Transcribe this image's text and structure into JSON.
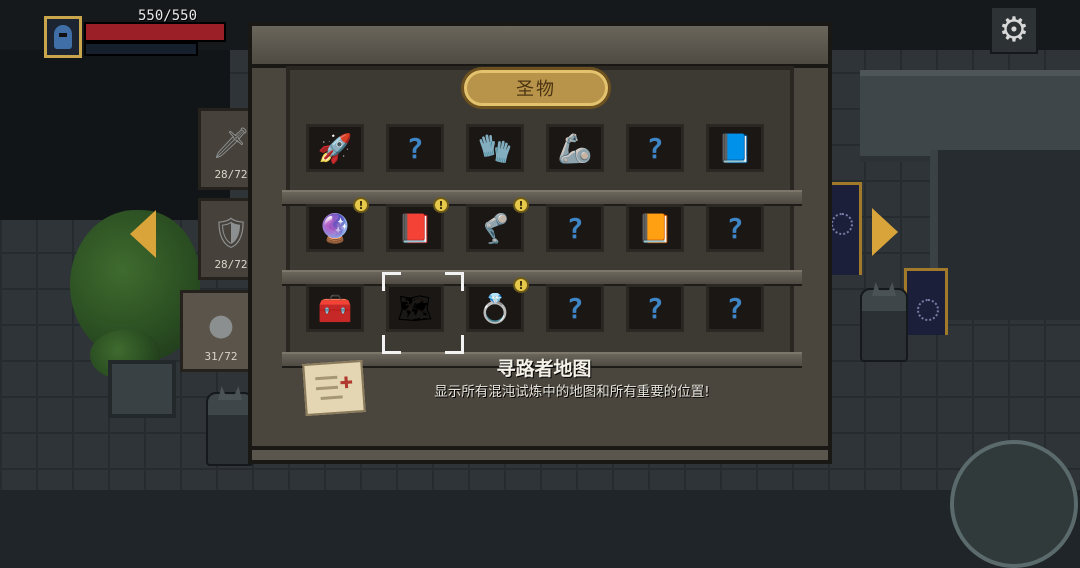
{
  "hud": {
    "hp_text": "550/550",
    "hp_fraction": 1.0,
    "settings_icon": "gear-icon"
  },
  "tabs": [
    {
      "icon": "sword-icon",
      "count": "28/72"
    },
    {
      "icon": "shield-heart-icon",
      "count": "28/72"
    },
    {
      "icon": "stone-relic-icon",
      "count": "31/72"
    }
  ],
  "panel": {
    "title": "圣物",
    "slots": [
      {
        "name": "rocket",
        "glyph": "🚀",
        "known": true,
        "new": false
      },
      {
        "name": "unknown",
        "glyph": "?",
        "known": false,
        "new": false
      },
      {
        "name": "brown-glove",
        "glyph": "🧤",
        "known": true,
        "new": false
      },
      {
        "name": "silver-gauntlet",
        "glyph": "🦾",
        "known": true,
        "new": false
      },
      {
        "name": "unknown",
        "glyph": "?",
        "known": false,
        "new": false
      },
      {
        "name": "star-book",
        "glyph": "📘",
        "known": true,
        "new": false
      },
      {
        "name": "orb",
        "glyph": "🔮",
        "known": true,
        "new": true
      },
      {
        "name": "red-card",
        "glyph": "📕",
        "known": true,
        "new": true
      },
      {
        "name": "blue-arm",
        "glyph": "🦿",
        "known": true,
        "new": true
      },
      {
        "name": "unknown",
        "glyph": "?",
        "known": false,
        "new": false
      },
      {
        "name": "gold-tome",
        "glyph": "📙",
        "known": true,
        "new": false
      },
      {
        "name": "unknown",
        "glyph": "?",
        "known": false,
        "new": false
      },
      {
        "name": "chest",
        "glyph": "🧰",
        "known": true,
        "new": false
      },
      {
        "name": "treasure-map",
        "glyph": "🗺",
        "known": true,
        "new": false
      },
      {
        "name": "ring-glove",
        "glyph": "💍",
        "known": true,
        "new": true
      },
      {
        "name": "unknown",
        "glyph": "?",
        "known": false,
        "new": false
      },
      {
        "name": "unknown",
        "glyph": "?",
        "known": false,
        "new": false
      },
      {
        "name": "unknown",
        "glyph": "?",
        "known": false,
        "new": false
      }
    ],
    "new_badge": "!"
  },
  "selected": {
    "name": "寻路者地图",
    "description": "显示所有混沌试炼中的地图和所有重要的位置!"
  }
}
